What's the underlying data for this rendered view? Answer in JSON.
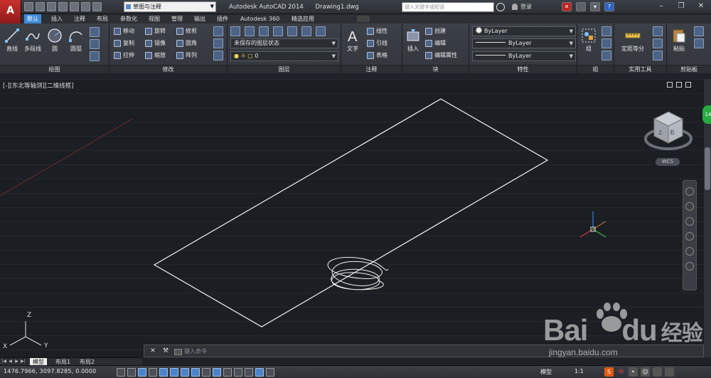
{
  "titlebar": {
    "workspace": "草图与注释",
    "app_name": "Autodesk AutoCAD 2014",
    "file_name": "Drawing1.dwg",
    "search_placeholder": "键入关键字或短语",
    "login": "登录",
    "logo": "A"
  },
  "tabs": [
    {
      "label": "默认",
      "active": true
    },
    {
      "label": "插入"
    },
    {
      "label": "注释"
    },
    {
      "label": "布局"
    },
    {
      "label": "参数化"
    },
    {
      "label": "视图"
    },
    {
      "label": "管理"
    },
    {
      "label": "输出"
    },
    {
      "label": "插件"
    },
    {
      "label": "Autodesk 360"
    },
    {
      "label": "精选应用"
    }
  ],
  "ribbon": {
    "draw": {
      "title": "绘图",
      "line": "直线",
      "polyline": "多段线",
      "circle": "圆",
      "arc": "圆弧"
    },
    "modify": {
      "title": "修改",
      "move": "移动",
      "rotate": "旋转",
      "trim": "修剪",
      "copy": "复制",
      "mirror": "镜像",
      "fillet": "圆角",
      "stretch": "拉伸",
      "scale": "缩放",
      "array": "阵列"
    },
    "layers": {
      "title": "图层",
      "state": "未保存的图层状态",
      "current": "0"
    },
    "annotation": {
      "title": "注释",
      "text": "文字",
      "linear": "线性",
      "leader": "引线",
      "table": "表格"
    },
    "block": {
      "title": "块",
      "insert": "插入",
      "create": "创建",
      "edit": "编辑",
      "edit_attr": "编辑属性"
    },
    "properties": {
      "title": "特性",
      "color": "ByLayer",
      "linetype": "ByLayer",
      "lineweight": "ByLayer"
    },
    "groups": {
      "title": "组",
      "group": "组"
    },
    "utilities": {
      "title": "实用工具",
      "measure": "定距等分"
    },
    "clipboard": {
      "title": "剪贴板",
      "paste": "粘贴"
    }
  },
  "viewport": {
    "label": "[-][东北等轴测][二维线框]",
    "wcs": "WCS",
    "ucs_z": "Z",
    "ucs_y": "Y",
    "ucs_x": "X",
    "cube_top": "上",
    "cube_right": "右"
  },
  "layout_tabs": [
    {
      "label": "模型",
      "active": true
    },
    {
      "label": "布局1"
    },
    {
      "label": "布局2"
    }
  ],
  "cmdline": {
    "placeholder": "键入命令"
  },
  "status": {
    "coords": "1476.7966, 3097.8285, 0.0000",
    "model": "模型",
    "scale": "1:1",
    "ime": "中"
  },
  "watermark": {
    "brand": "Bai",
    "brand_end": "du",
    "cn": "经验",
    "url": "jingyan.baidu.com"
  },
  "colors": {
    "accent": "#3e8ad8",
    "background": "#1b1e23",
    "geometry": "#ffffff"
  }
}
